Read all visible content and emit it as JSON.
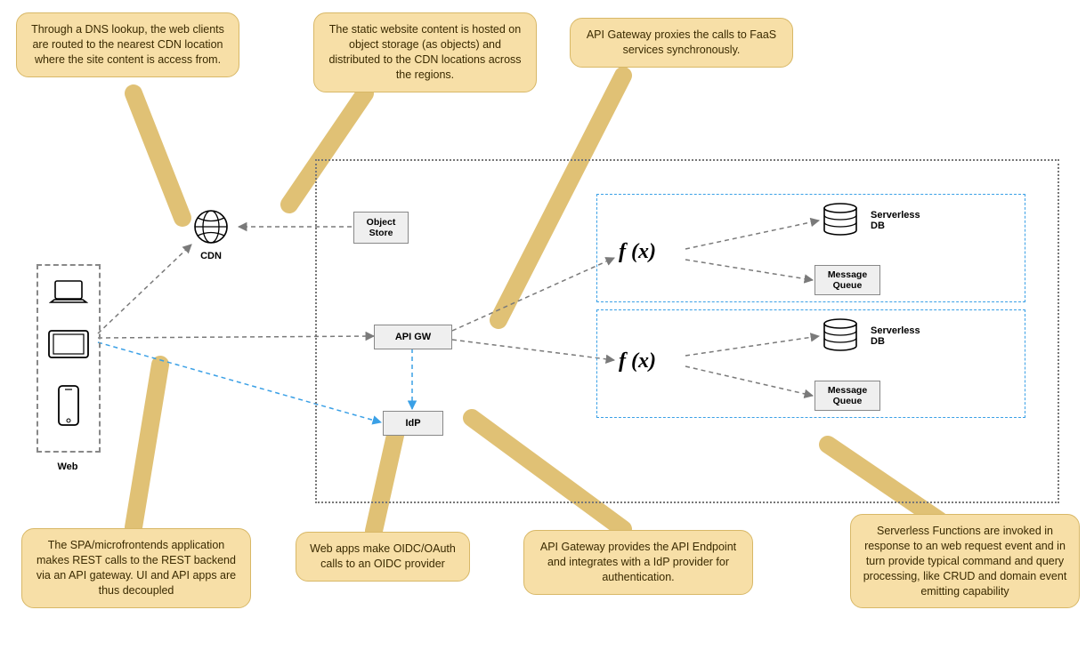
{
  "callouts": {
    "dns": "Through a DNS lookup, the web clients are routed to the nearest CDN location where the site content is access from.",
    "objectStore": "The static website content is hosted on object storage (as objects) and distributed to the CDN locations across the regions.",
    "apiGwProxy": "API Gateway proxies the calls to FaaS services synchronously.",
    "spa": "The SPA/microfrontends application makes REST calls to the REST backend via an API gateway. UI and API apps are thus decoupled",
    "oidc": "Web apps make OIDC/OAuth calls to an OIDC provider",
    "apiGwIdp": "API Gateway provides the API Endpoint and integrates with a IdP provider for authentication.",
    "serverless": "Serverless Functions are invoked in response to an web request event and in turn provide typical command and query processing, like CRUD and domain event emitting capability"
  },
  "labels": {
    "web": "Web",
    "cdn": "CDN"
  },
  "nodes": {
    "objectStore": "Object\nStore",
    "apiGw": "API GW",
    "idp": "IdP",
    "serverlessDb": "Serverless\nDB",
    "messageQueue": "Message\nQueue"
  },
  "fx": "f (x)"
}
